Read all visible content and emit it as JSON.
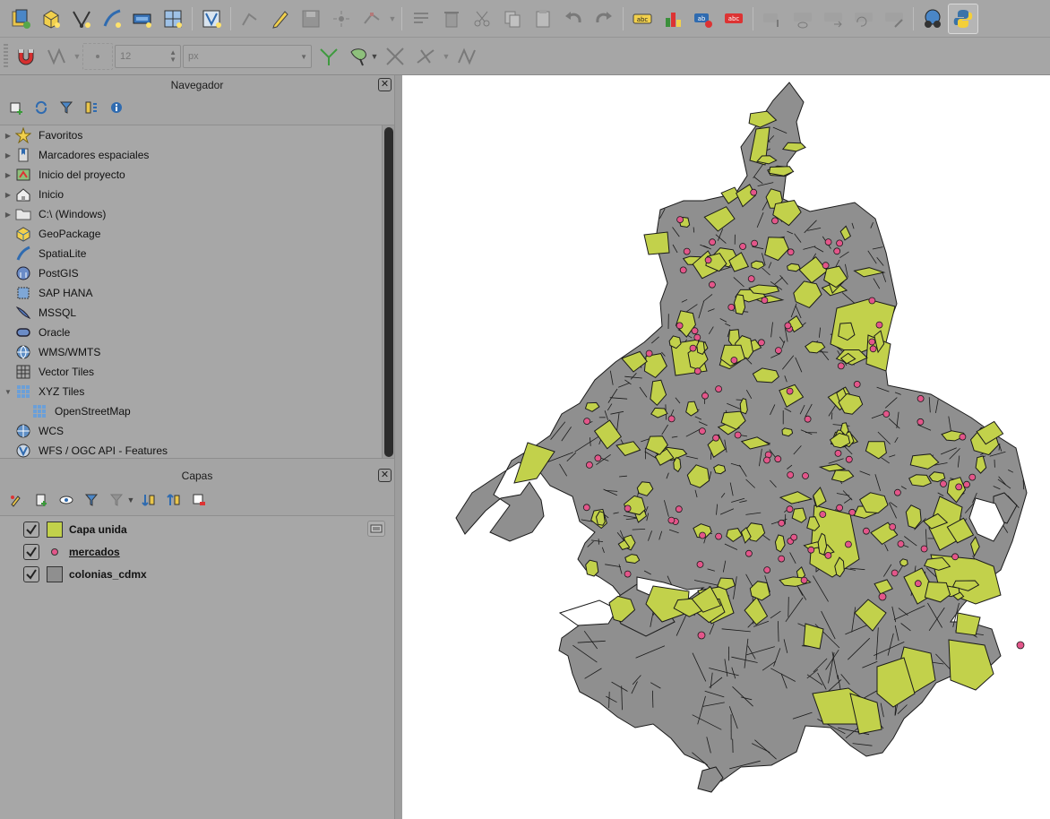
{
  "colors": {
    "toolbar_bg": "#a6a6a6",
    "panel_bg": "#a7a7a7",
    "map_bg": "#ffffff",
    "colonias_fill": "#8f8f8f",
    "capa_unida_fill": "#c2d14b",
    "mercados_fill": "#e3568a",
    "outline": "#1a1a1a"
  },
  "toolbar_row1": {
    "icons": [
      "data-source-manager-icon",
      "new-geopackage-layer-icon",
      "new-shapefile-layer-icon",
      "new-spatialite-layer-icon",
      "new-temporary-layer-icon",
      "new-virtual-layer-icon",
      "new-vector-tile-layer-icon",
      "digitize-icon",
      "toggle-editing-icon",
      "save-edits-icon",
      "add-point-icon",
      "vertex-tool-icon",
      "dropdown-icon",
      "modify-attributes-icon",
      "delete-selected-icon",
      "cut-features-icon",
      "copy-features-icon",
      "paste-features-icon",
      "undo-icon",
      "redo-icon",
      "label-tool-icon",
      "diagram-tool-icon",
      "layer-labeling-icon",
      "highlight-pinned-labels-icon",
      "pin-label-icon",
      "show-hide-label-icon",
      "move-label-icon",
      "rotate-label-icon",
      "change-label-icon",
      "metasearch-icon",
      "python-console-icon"
    ]
  },
  "toolbar_row2": {
    "snap_size_value": "12",
    "snap_unit_value": "px",
    "icons": [
      "snapping-magnet-icon",
      "snapping-mode-icon",
      "snapping-type-icon",
      "topology-editing-icon",
      "avoid-overlap-icon",
      "self-snapping-icon",
      "snap-intersection-icon",
      "tracing-icon"
    ]
  },
  "navigator": {
    "title": "Navegador",
    "items": [
      {
        "label": "Favoritos",
        "icon": "star-icon",
        "expandable": true
      },
      {
        "label": "Marcadores espaciales",
        "icon": "bookmark-icon",
        "expandable": true
      },
      {
        "label": "Inicio del proyecto",
        "icon": "project-home-icon",
        "expandable": true
      },
      {
        "label": "Inicio",
        "icon": "home-icon",
        "expandable": true
      },
      {
        "label": "C:\\ (Windows)",
        "icon": "folder-icon",
        "expandable": true
      },
      {
        "label": "GeoPackage",
        "icon": "geopackage-icon",
        "expandable": false
      },
      {
        "label": "SpatiaLite",
        "icon": "spatialite-icon",
        "expandable": false
      },
      {
        "label": "PostGIS",
        "icon": "postgis-icon",
        "expandable": false
      },
      {
        "label": "SAP HANA",
        "icon": "sap-hana-icon",
        "expandable": false
      },
      {
        "label": "MSSQL",
        "icon": "mssql-icon",
        "expandable": false
      },
      {
        "label": "Oracle",
        "icon": "oracle-icon",
        "expandable": false
      },
      {
        "label": "WMS/WMTS",
        "icon": "wms-icon",
        "expandable": false
      },
      {
        "label": "Vector Tiles",
        "icon": "vector-tiles-icon",
        "expandable": false
      },
      {
        "label": "XYZ Tiles",
        "icon": "xyz-tiles-icon",
        "expandable": true,
        "expanded": true
      },
      {
        "label": "OpenStreetMap",
        "icon": "xyz-tiles-icon",
        "child": true
      },
      {
        "label": "WCS",
        "icon": "wcs-icon",
        "expandable": false
      },
      {
        "label": "WFS / OGC API - Features",
        "icon": "wfs-icon",
        "expandable": false
      }
    ]
  },
  "layers": {
    "title": "Capas",
    "items": [
      {
        "label": "Capa unida",
        "checked": true,
        "symbol": "fill",
        "color": "#c2d14b",
        "underlined": false
      },
      {
        "label": "mercados",
        "checked": true,
        "symbol": "point",
        "color": "#e3568a",
        "underlined": true
      },
      {
        "label": "colonias_cdmx",
        "checked": true,
        "symbol": "fill",
        "color": "#8f8f8f",
        "underlined": false
      }
    ]
  }
}
